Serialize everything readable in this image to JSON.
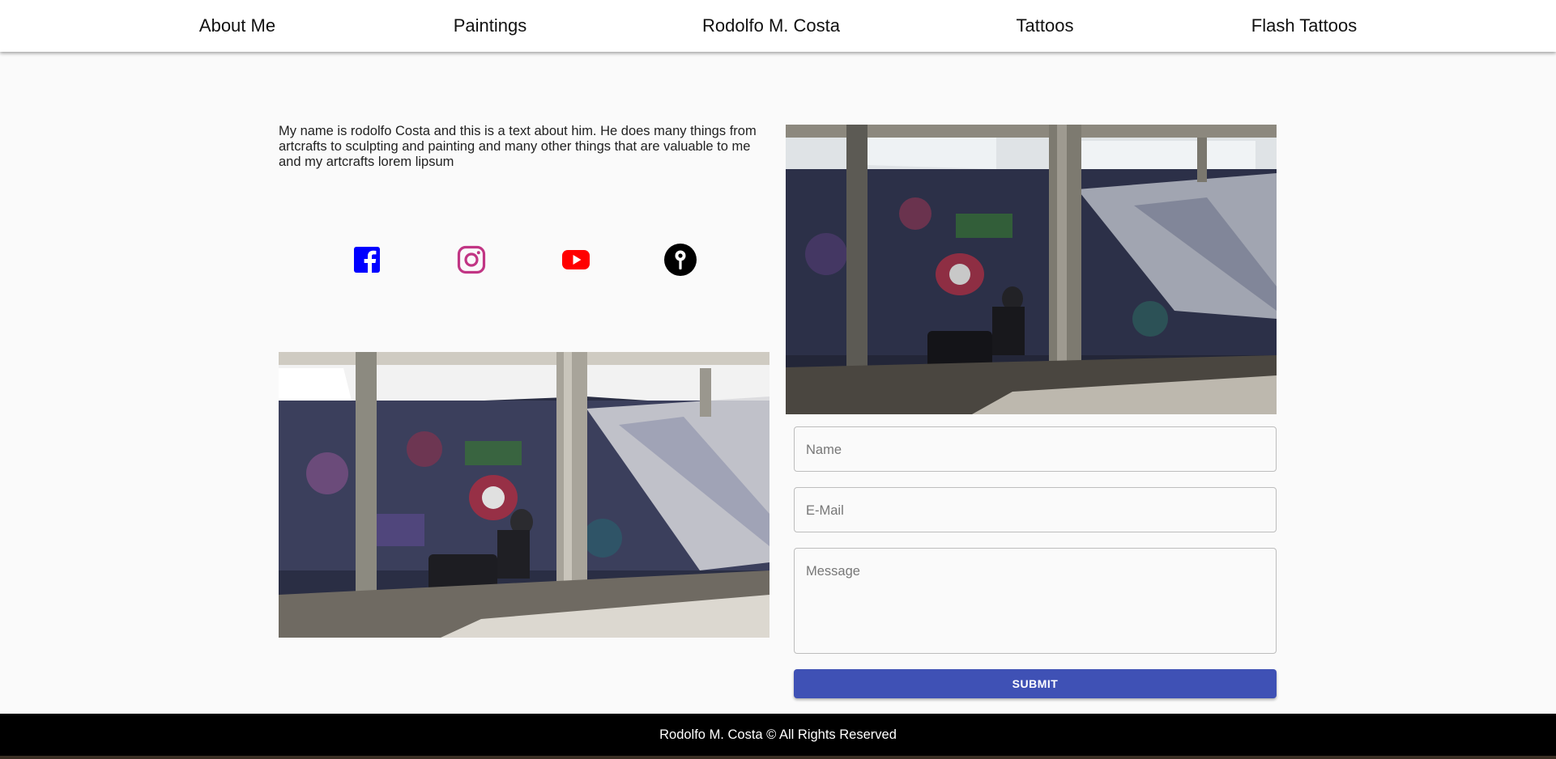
{
  "nav": {
    "items": [
      "About Me",
      "Paintings",
      "Rodolfo M. Costa",
      "Tattoos",
      "Flash Tattoos"
    ]
  },
  "about": {
    "text": "My name is rodolfo Costa and this is a text about him. He does many things from artcrafts to sculpting and painting and many other things that are valuable to me and my artcrafts lorem lipsum"
  },
  "social": [
    {
      "icon": "facebook-icon",
      "color": "#0000ff"
    },
    {
      "icon": "instagram-icon",
      "color": "#c13584"
    },
    {
      "icon": "youtube-icon",
      "color": "#ff0000"
    },
    {
      "icon": "map-pin-icon",
      "color": "#000000"
    }
  ],
  "form": {
    "name_placeholder": "Name",
    "email_placeholder": "E-Mail",
    "message_placeholder": "Message",
    "submit_label": "SUBMIT"
  },
  "footer": {
    "text": "Rodolfo M. Costa © All Rights Reserved"
  },
  "colors": {
    "accent": "#3f51b5",
    "footer_bg": "#000000",
    "page_bg": "#fafafa"
  }
}
